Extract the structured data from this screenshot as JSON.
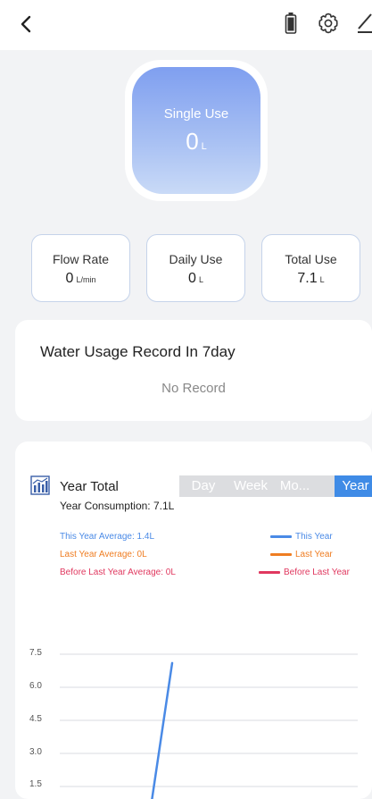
{
  "header": {
    "back_icon": "chevron-left-icon",
    "battery_icon": "battery-icon",
    "settings_icon": "gear-icon",
    "edit_icon": "pencil-icon"
  },
  "hero": {
    "title": "Single Use",
    "value": "0",
    "unit": "L"
  },
  "stats": [
    {
      "label": "Flow Rate",
      "value": "0",
      "unit": "L/min"
    },
    {
      "label": "Daily Use",
      "value": "0",
      "unit": "L"
    },
    {
      "label": "Total Use",
      "value": "7.1",
      "unit": "L"
    }
  ],
  "record": {
    "title": "Water Usage Record In 7day",
    "empty_text": "No Record"
  },
  "year_card": {
    "title": "Year Total",
    "consumption": "Year Consumption: 7.1L",
    "tabs": [
      "Day",
      "Week",
      "Mo...",
      "Year"
    ],
    "active_tab": "Year",
    "averages": [
      {
        "label": "This Year Average: 1.4L",
        "color": "#4a8ae6"
      },
      {
        "label": "Last Year Average: 0L",
        "color": "#ef7d22"
      },
      {
        "label": "Before Last Year Average: 0L",
        "color": "#e0385f"
      }
    ]
  },
  "colors": {
    "accent": "#3f8be6",
    "this_year": "#4a8ae6",
    "last_year": "#ef7d22",
    "before_last_year": "#e0385f"
  },
  "chart_data": {
    "type": "line",
    "series": [
      {
        "name": "This Year",
        "color": "#4a8ae6",
        "x": [
          0,
          1
        ],
        "y": [
          0,
          7.1
        ]
      },
      {
        "name": "Last Year",
        "color": "#ef7d22"
      },
      {
        "name": "Before Last Year",
        "color": "#e0385f"
      }
    ],
    "yticks": [
      "7.5",
      "6.0",
      "4.5",
      "3.0",
      "1.5"
    ],
    "ylim": [
      0,
      7.5
    ],
    "grid": true,
    "legend_position": "top-right"
  }
}
